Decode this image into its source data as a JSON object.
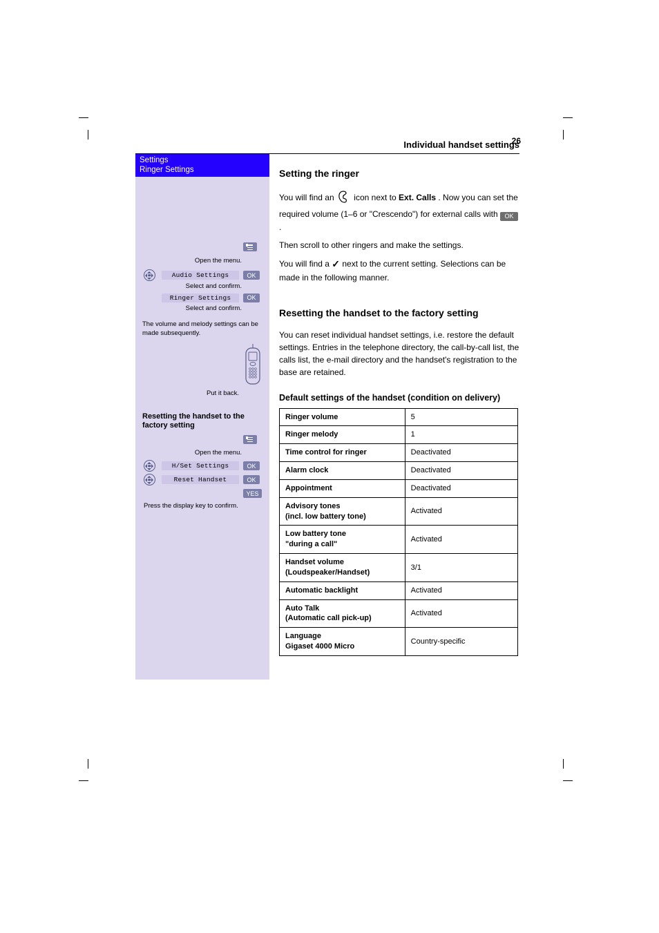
{
  "header": {
    "running_title": "Individual handset settings",
    "page_number": "26"
  },
  "sidebar": {
    "header_line1": "Settings",
    "header_line2": "Ringer Settings",
    "step1": {
      "menu_label": "Open the menu.",
      "nav1_lcd": "Audio Settings",
      "nav1_note": "Select and confirm.",
      "nav2_lcd": "Ringer Settings",
      "nav2_note": "Select and confirm.",
      "after_note": "The volume and melody settings can be made subsequently.",
      "handset_caption": "Put it back."
    },
    "section2_title": "Resetting the handset to the factory setting",
    "step2": {
      "menu_label": "Open the menu.",
      "nav1_lcd": "H/Set Settings",
      "nav2_lcd": "Reset Handset",
      "yes_note": "Press the display key to confirm."
    }
  },
  "main": {
    "section1": {
      "h": "Setting the ringer",
      "para1_pre": "You will find an ",
      "para1_after_icon": " icon next to",
      "para1_bold1": " Ext. Calls",
      "para1_mid": ". Now you can set the required volume (1–6 or \"Crescendo\") for external calls with",
      "para1_after_ok": ".",
      "line_scroll": "Then scroll to other ringers and make the settings.",
      "para2_pre": "You will find a ",
      "para2_after_check": " next to the current setting. Selections can be made in the following manner."
    },
    "section2": {
      "h": "Resetting the handset to the factory setting",
      "para": "You can reset individual handset settings, i.e. restore the default settings. Entries in the telephone directory, the call-by-call list, the calls list, the e-mail directory and the handset's registration to the base are retained."
    },
    "section3": {
      "h": "Default settings of the handset (condition on delivery)",
      "rows": [
        {
          "left": "Ringer volume",
          "right": "5"
        },
        {
          "left": "Ringer melody",
          "right": "1"
        },
        {
          "left": "Time control for ringer",
          "right": "Deactivated"
        },
        {
          "left": "Alarm clock",
          "right": "Deactivated"
        },
        {
          "left": "Appointment",
          "right": "Deactivated"
        },
        {
          "left": "Advisory tones\n(incl. low battery tone)",
          "right": "Activated"
        },
        {
          "left": "Low battery tone\n\"during a call\"",
          "right": "Activated"
        },
        {
          "left": "Handset volume\n(Loudspeaker/Handset)",
          "right": "3/1"
        },
        {
          "left": "Automatic backlight",
          "right": "Activated"
        },
        {
          "left": "Auto Talk\n(Automatic call pick-up)",
          "right": "Activated"
        },
        {
          "left": "Language\nGigaset 4000 Micro",
          "right": "Country-specific"
        }
      ]
    }
  }
}
